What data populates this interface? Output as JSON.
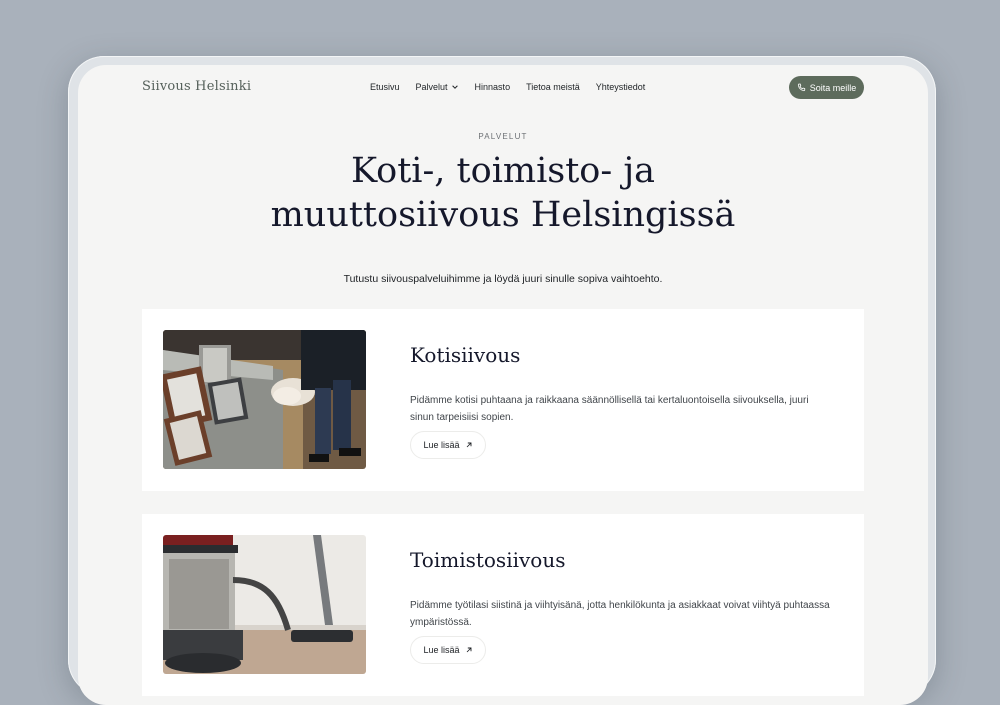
{
  "brand": {
    "name": "Siivous Helsinki"
  },
  "nav": {
    "items": [
      "Etusivu",
      "Palvelut",
      "Hinnasto",
      "Tietoa meistä",
      "Yhteystiedot"
    ],
    "cta": "Soita meille"
  },
  "hero": {
    "eyebrow": "PALVELUT",
    "title_line1": "Koti-, toimisto- ja",
    "title_line2": "muuttosiivous Helsingissä",
    "subtitle": "Tutustu siivouspalveluihimme ja löydä juuri sinulle sopiva vaihtoehto."
  },
  "services": [
    {
      "title": "Kotisiivous",
      "text": "Pidämme kotisi puhtaana ja raikkaana säännöllisellä tai kertaluontoisella siivouksella, juuri sinun tarpeisiisi sopien.",
      "button": "Lue lisää"
    },
    {
      "title": "Toimistosiivous",
      "text": "Pidämme työtilasi siistinä ja viihtyisänä, jotta henkilökunta ja asiakkaat voivat viihtyä puhtaassa ympäristössä.",
      "button": "Lue lisää"
    }
  ],
  "colors": {
    "accent": "#5d6b5c",
    "heading": "#15182b",
    "background": "#a9b1bb"
  }
}
